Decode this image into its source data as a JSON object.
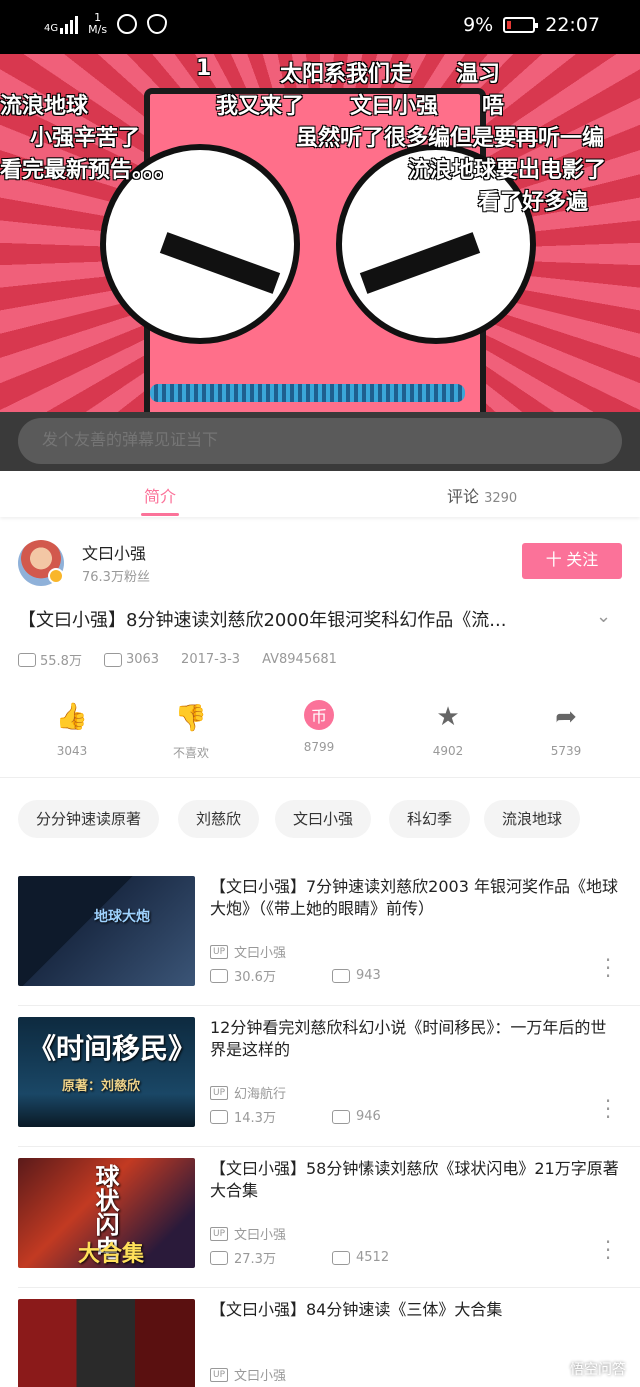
{
  "status_bar": {
    "network_type": "4G",
    "speed": "1",
    "speed_unit": "M/s",
    "battery": "9%",
    "time": "22:07"
  },
  "video": {
    "danmaku": [
      "1",
      "太阳系我们走",
      "温习",
      "流浪地球",
      "我又来了",
      "文曰小强",
      "唔",
      "小强辛苦了",
      "虽然听了很多编但是要再听一编",
      "看完最新预告。。。",
      "流浪地球要出电影了",
      "看了好多遍"
    ],
    "danmaku_input_placeholder": "发个友善的弹幕见证当下"
  },
  "tabs": {
    "intro": "简介",
    "comments": "评论",
    "comments_count": "3290"
  },
  "uploader": {
    "name": "文曰小强",
    "fans": "76.3万粉丝",
    "follow_label": "十 关注"
  },
  "video_info": {
    "title": "【文曰小强】8分钟速读刘慈欣2000年银河奖科幻作品《流...",
    "views": "55.8万",
    "danmaku_count": "3063",
    "date": "2017-3-3",
    "av": "AV8945681"
  },
  "actions": {
    "like": "3043",
    "dislike": "不喜欢",
    "coin": "8799",
    "favorite": "4902",
    "share": "5739"
  },
  "tags": [
    "分分钟速读原著",
    "刘慈欣",
    "文曰小强",
    "科幻季",
    "流浪地球"
  ],
  "recommendations": [
    {
      "title": "【文曰小强】7分钟速读刘慈欣2003 年银河奖作品《地球大炮》（《带上她的眼睛》前传）",
      "up_label": "UP",
      "uploader": "文曰小强",
      "views": "30.6万",
      "danmaku": "943",
      "thumb_text": "地球大炮"
    },
    {
      "title": "12分钟看完刘慈欣科幻小说《时间移民》：一万年后的世界是这样的",
      "up_label": "UP",
      "uploader": "幻海航行",
      "views": "14.3万",
      "danmaku": "946",
      "thumb_text": "《时间移民》",
      "thumb_sub": "原著：刘慈欣"
    },
    {
      "title": "【文曰小强】58分钟愫读刘慈欣《球状闪电》21万字原著大合集",
      "up_label": "UP",
      "uploader": "文曰小强",
      "views": "27.3万",
      "danmaku": "4512",
      "thumb_text": "球状闪电",
      "thumb_sub": "大合集"
    },
    {
      "title": "【文曰小强】84分钟速读《三体》大合集",
      "up_label": "UP",
      "uploader": "文曰小强",
      "views": "",
      "danmaku": ""
    }
  ],
  "watermark": "悟空问答"
}
